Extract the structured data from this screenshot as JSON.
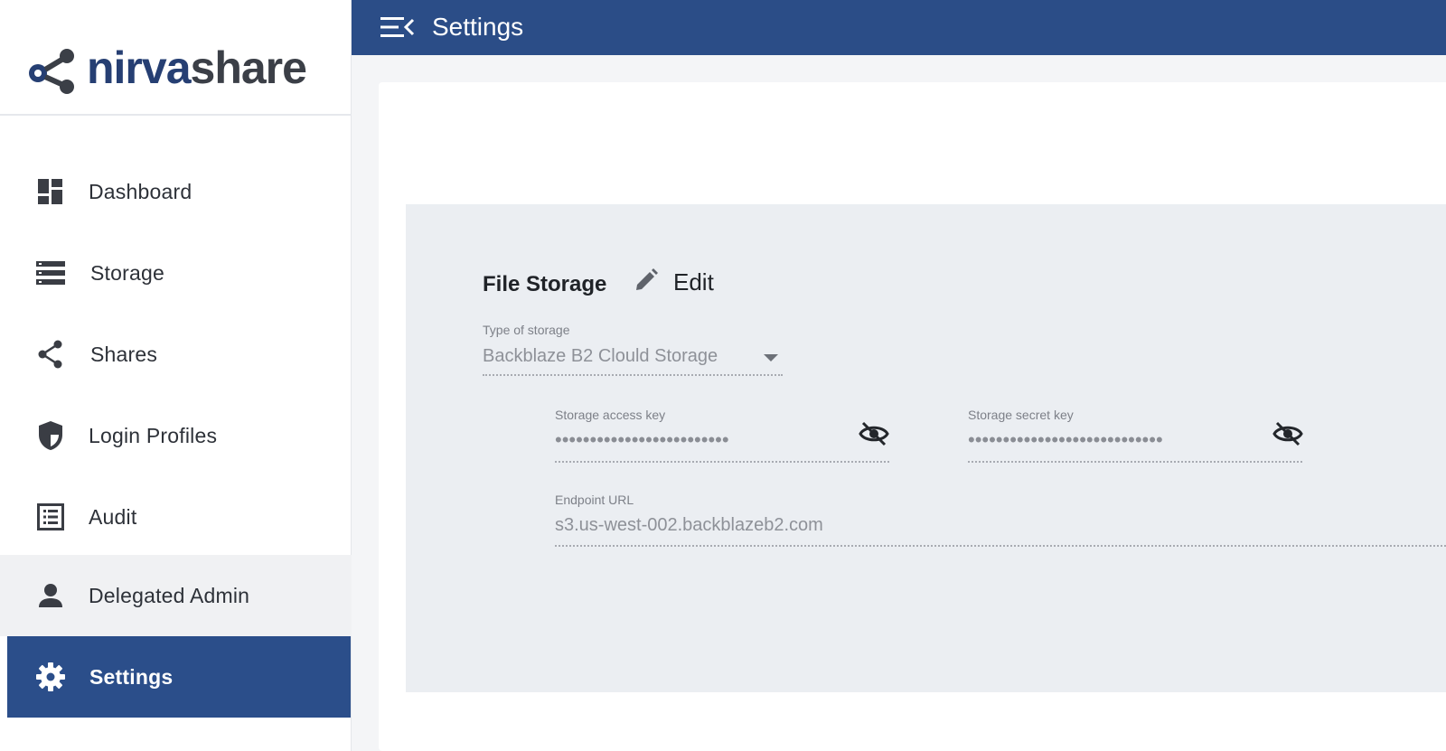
{
  "app": {
    "brand_part1": "nirva",
    "brand_part2": "share",
    "brand_color": "#263f73"
  },
  "sidebar": {
    "items": [
      {
        "label": "Dashboard",
        "icon": "dashboard-icon"
      },
      {
        "label": "Storage",
        "icon": "storage-icon"
      },
      {
        "label": "Shares",
        "icon": "share-icon"
      },
      {
        "label": "Login Profiles",
        "icon": "shield-icon"
      },
      {
        "label": "Audit",
        "icon": "list-icon"
      },
      {
        "label": "Delegated Admin",
        "icon": "person-icon"
      },
      {
        "label": "Settings",
        "icon": "gear-icon",
        "active": true
      }
    ],
    "active_color": "#2b4e8a"
  },
  "header": {
    "title": "Settings",
    "bg_color": "#2b4d87"
  },
  "file_storage": {
    "title": "File Storage",
    "edit_label": "Edit",
    "type_label": "Type of storage",
    "type_value": "Backblaze B2 Clould Storage",
    "access_key_label": "Storage access key",
    "access_key_value": "•••••••••••••••••••••••••",
    "secret_key_label": "Storage secret key",
    "secret_key_value": "••••••••••••••••••••••••••••",
    "endpoint_label": "Endpoint URL",
    "endpoint_value": "s3.us-west-002.backblazeb2.com"
  }
}
